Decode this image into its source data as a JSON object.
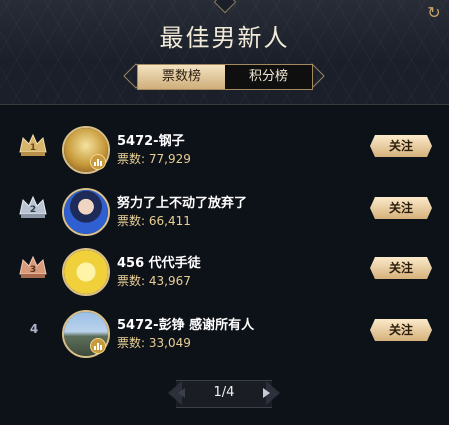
{
  "header": {
    "title": "最佳男新人",
    "refresh_icon": "refresh-icon"
  },
  "tabs": [
    {
      "label": "票数榜",
      "active": true
    },
    {
      "label": "积分榜",
      "active": false
    }
  ],
  "votes_prefix": "票数: ",
  "entries": [
    {
      "rank": "1",
      "name": "5472-钢子",
      "votes": "77,929",
      "follow_label": "关注",
      "crown": "gold",
      "avatar_color": "#d2b25c",
      "badge": true
    },
    {
      "rank": "2",
      "name": "努力了上不动了放弃了",
      "votes": "66,411",
      "follow_label": "关注",
      "crown": "silver",
      "avatar_color": "#2f5fd1",
      "badge": false
    },
    {
      "rank": "3",
      "name": "456 代代手徒",
      "votes": "43,967",
      "follow_label": "关注",
      "crown": "bronze",
      "avatar_color": "#f0d13b",
      "badge": false
    },
    {
      "rank": "4",
      "name": "5472-彭铮 感谢所有人",
      "votes": "33,049",
      "follow_label": "关注",
      "crown": "none",
      "avatar_color": "#6b8db8",
      "badge": true
    }
  ],
  "pager": {
    "label": "1/4"
  },
  "colors": {
    "gold": "#d7b56d",
    "background": "#0d1118"
  }
}
